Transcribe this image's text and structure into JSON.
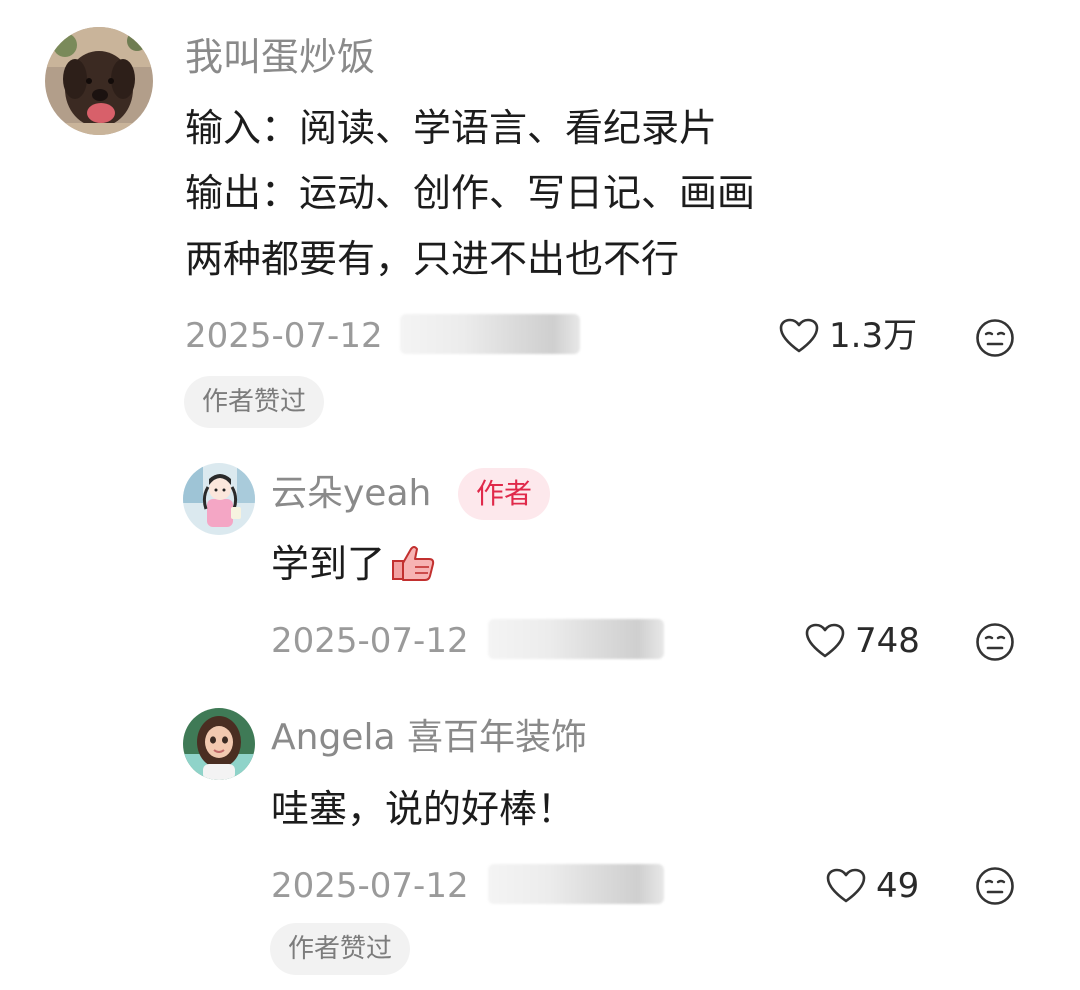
{
  "comment": {
    "username": "我叫蛋炒饭",
    "lines": [
      "输入：阅读、学语言、看纪录片",
      "输出：运动、创作、写日记、画画",
      "两种都要有，只进不出也不行"
    ],
    "date": "2025-07-12",
    "likes": "1.3万",
    "tag": "作者赞过"
  },
  "replies": [
    {
      "username": "云朵yeah",
      "badge": "作者",
      "text": "学到了",
      "date": "2025-07-12",
      "likes": "748"
    },
    {
      "username": "Angela 喜百年装饰",
      "text": "哇塞，说的好棒！",
      "date": "2025-07-12",
      "likes": "49",
      "tag": "作者赞过"
    }
  ],
  "icons": {
    "like": "heart-outline-icon",
    "more": "neutral-face-icon",
    "reaction": "thumbs-up-emoji"
  },
  "colors": {
    "author_badge_bg": "#fde8ec",
    "author_badge_text": "#e0294a",
    "name_gray": "#8a8a8a"
  }
}
